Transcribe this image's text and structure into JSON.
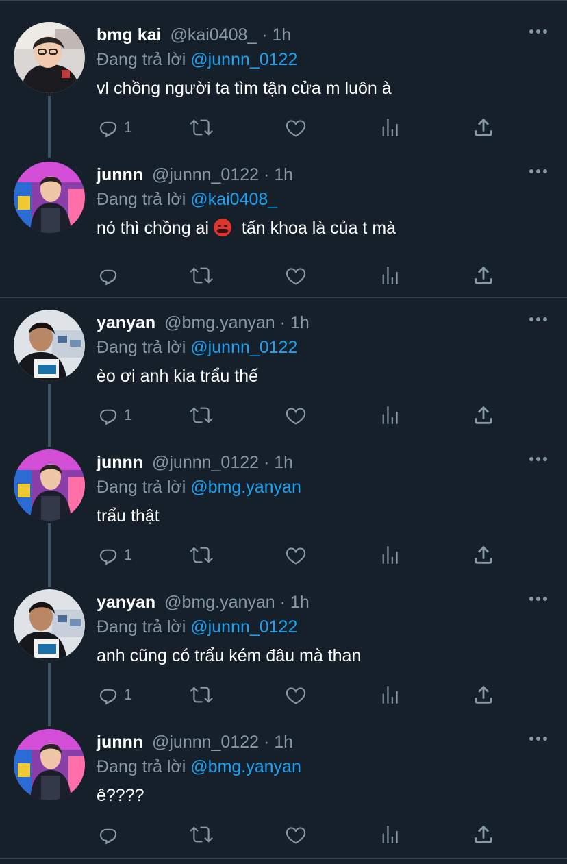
{
  "tweets": [
    {
      "name": "bmg kai",
      "handle": "@kai0408_ · 1h",
      "reply_prefix": "Đang trả lời",
      "reply_to": "@junnn_0122",
      "text": "vl chồng người ta tìm tận cửa m luôn à",
      "reply_count": "1",
      "avatar": "avatar-kai"
    },
    {
      "name": "junnn",
      "handle": "@junnn_0122 · 1h",
      "reply_prefix": "Đang trả lời",
      "reply_to": "@kai0408_",
      "text_before_emoji": "nó thì chồng ai",
      "emoji": "face-with-symbols-on-mouth",
      "text_after_emoji": "tấn khoa là của t mà",
      "reply_count": "",
      "avatar": "avatar-junnn"
    },
    {
      "name": "yanyan",
      "handle": "@bmg.yanyan · 1h",
      "reply_prefix": "Đang trả lời",
      "reply_to": "@junnn_0122",
      "text": "èo ơi anh kia trẩu thế",
      "reply_count": "1",
      "avatar": "avatar-yanyan"
    },
    {
      "name": "junnn",
      "handle": "@junnn_0122 · 1h",
      "reply_prefix": "Đang trả lời",
      "reply_to": "@bmg.yanyan",
      "text": "trẩu thật",
      "reply_count": "1",
      "avatar": "avatar-junnn"
    },
    {
      "name": "yanyan",
      "handle": "@bmg.yanyan · 1h",
      "reply_prefix": "Đang trả lời",
      "reply_to": "@junnn_0122",
      "text": "anh cũng có trẩu kém đâu mà than",
      "reply_count": "1",
      "avatar": "avatar-yanyan"
    },
    {
      "name": "junnn",
      "handle": "@junnn_0122 · 1h",
      "reply_prefix": "Đang trả lời",
      "reply_to": "@bmg.yanyan",
      "text": "ê????",
      "reply_count": "",
      "avatar": "avatar-junnn"
    }
  ],
  "colors": {
    "background": "#15202b",
    "mention": "#1da1f2",
    "secondary_text": "#8899a6",
    "divider": "#38444d"
  },
  "icons": [
    "reply-icon",
    "retweet-icon",
    "like-icon",
    "analytics-icon",
    "share-icon",
    "more-icon"
  ]
}
